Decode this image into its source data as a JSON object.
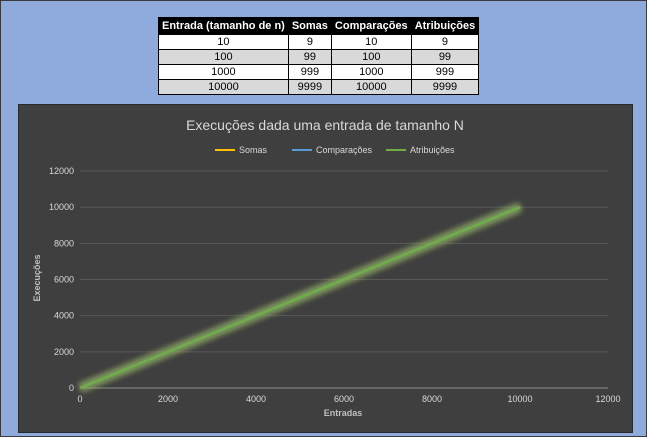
{
  "table": {
    "headers": [
      "Entrada (tamanho de n)",
      "Somas",
      "Comparações",
      "Atribuições"
    ],
    "rows": [
      [
        "10",
        "9",
        "10",
        "9"
      ],
      [
        "100",
        "99",
        "100",
        "99"
      ],
      [
        "1000",
        "999",
        "1000",
        "999"
      ],
      [
        "10000",
        "9999",
        "10000",
        "9999"
      ]
    ]
  },
  "chart_data": {
    "type": "line",
    "title": "Execuções dada uma entrada de tamanho N",
    "xlabel": "Entradas",
    "ylabel": "Execuções",
    "xlim": [
      0,
      12000
    ],
    "ylim": [
      0,
      12000
    ],
    "xticks": [
      "0",
      "2000",
      "4000",
      "6000",
      "8000",
      "10000",
      "12000"
    ],
    "yticks": [
      "0",
      "2000",
      "4000",
      "6000",
      "8000",
      "10000",
      "12000"
    ],
    "grid": "horizontal",
    "legend_position": "top",
    "series": [
      {
        "name": "Somas",
        "color": "#ffc000",
        "x": [
          10,
          100,
          1000,
          10000
        ],
        "y": [
          9,
          99,
          999,
          9999
        ]
      },
      {
        "name": "Comparações",
        "color": "#5b9bd5",
        "x": [
          10,
          100,
          1000,
          10000
        ],
        "y": [
          10,
          100,
          1000,
          10000
        ]
      },
      {
        "name": "Atribuições",
        "color": "#70ad47",
        "x": [
          10,
          100,
          1000,
          10000
        ],
        "y": [
          9,
          99,
          999,
          9999
        ]
      }
    ]
  }
}
